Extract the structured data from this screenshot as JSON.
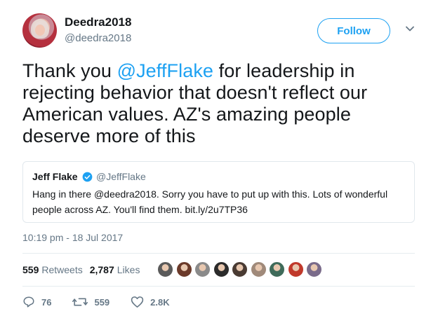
{
  "user": {
    "display_name": "Deedra2018",
    "handle": "@deedra2018"
  },
  "follow_label": "Follow",
  "tweet": {
    "before_mention": "Thank you ",
    "mention": "@JeffFlake",
    "after_mention": " for leadership in rejecting behavior that doesn't reflect our American values. AZ's amazing people deserve more of this"
  },
  "quote": {
    "name": "Jeff Flake",
    "handle": "@JeffFlake",
    "text": "Hang in there @deedra2018. Sorry you have to put up with this. Lots of wonderful people across AZ. You'll find them. bit.ly/2u7TP36"
  },
  "timestamp": "10:19 pm - 18 Jul 2017",
  "stats": {
    "retweets_count": "559",
    "retweets_label": "Retweets",
    "likes_count": "2,787",
    "likes_label": "Likes"
  },
  "liker_colors": [
    "#5a5a5a",
    "#6b3a2a",
    "#8a8a8a",
    "#2b2b2b",
    "#4a3b33",
    "#a08a7a",
    "#3f6b5a",
    "#c0392b",
    "#7a6b8a"
  ],
  "actions": {
    "replies": "76",
    "retweets": "559",
    "likes": "2.8K"
  },
  "colors": {
    "accent": "#1da1f2",
    "muted": "#657786",
    "text": "#14171a"
  }
}
